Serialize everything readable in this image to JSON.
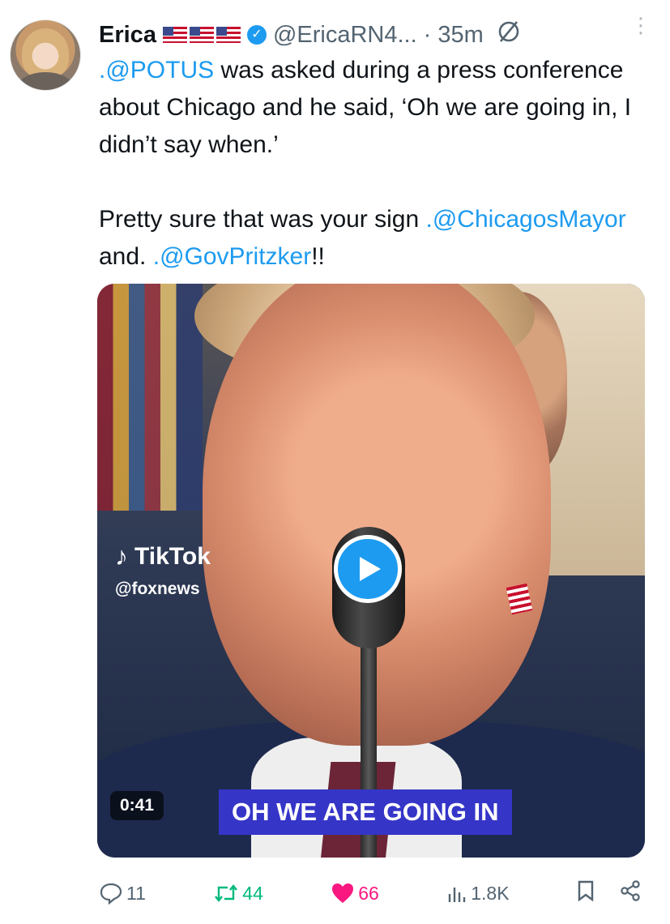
{
  "tweet": {
    "author_name": "Erica",
    "handle": "@EricaRN4...",
    "separator": "·",
    "time": "35m",
    "verified_icon": "verified-badge-icon",
    "text": {
      "p1_mention": ".@POTUS",
      "p1_rest": " was asked during a press conference about Chicago and he said, ‘Oh we are going in, I didn’t say when.’",
      "p2_start": "Pretty sure that was your sign ",
      "p2_mention1": ".@ChicagosMayor",
      "p2_mid": " and. ",
      "p2_mention2": ".@GovPritzker",
      "p2_end": "!!"
    }
  },
  "media": {
    "watermark_brand": "TikTok",
    "watermark_handle": "@foxnews",
    "duration": "0:41",
    "caption": "OH WE ARE GOING IN",
    "play_icon": "play-icon"
  },
  "actions": {
    "reply_count": "11",
    "retweet_count": "44",
    "like_count": "66",
    "views_count": "1.8K"
  },
  "colors": {
    "link": "#1d9bf0",
    "retweet": "#00ba7c",
    "like": "#f91880",
    "caption_bg": "#3535c8"
  }
}
